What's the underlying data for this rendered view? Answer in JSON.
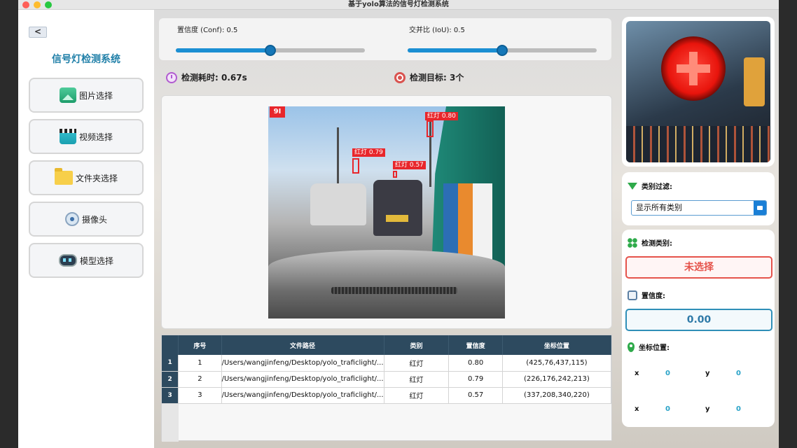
{
  "window": {
    "title": "基于yolo算法的信号灯检测系统"
  },
  "sidebar": {
    "back_label": "<",
    "app_title": "信号灯检测系统",
    "items": [
      {
        "label": "图片选择",
        "icon": "image-icon"
      },
      {
        "label": "视频选择",
        "icon": "video-icon"
      },
      {
        "label": "文件夹选择",
        "icon": "folder-icon"
      },
      {
        "label": "摄像头",
        "icon": "camera-icon"
      },
      {
        "label": "模型选择",
        "icon": "model-icon"
      }
    ]
  },
  "sliders": {
    "conf": {
      "label": "置信度 (Conf): 0.5",
      "value": 0.5
    },
    "iou": {
      "label": "交并比 (IoU): 0.5",
      "value": 0.5
    }
  },
  "stats": {
    "time": "检测耗时: 0.67s",
    "targets": "检测目标: 3个"
  },
  "detections_overlay": {
    "logo": "9I",
    "labels": [
      "红灯 0.80",
      "红灯 0.79",
      "红灯 0.57"
    ]
  },
  "table": {
    "headers": [
      "序号",
      "文件路径",
      "类别",
      "置信度",
      "坐标位置"
    ],
    "rows": [
      {
        "row": "1",
        "id": "1",
        "path": "/Users/wangjinfeng/Desktop/yolo_traficlight/...",
        "cls": "红灯",
        "conf": "0.80",
        "coords": "(425,76,437,115)"
      },
      {
        "row": "2",
        "id": "2",
        "path": "/Users/wangjinfeng/Desktop/yolo_traficlight/...",
        "cls": "红灯",
        "conf": "0.79",
        "coords": "(226,176,242,213)"
      },
      {
        "row": "3",
        "id": "3",
        "path": "/Users/wangjinfeng/Desktop/yolo_traficlight/...",
        "cls": "红灯",
        "conf": "0.57",
        "coords": "(337,208,340,220)"
      }
    ]
  },
  "filter": {
    "title": "类别过滤:",
    "selected": "显示所有类别"
  },
  "info": {
    "class_title": "检测类别:",
    "class_value": "未选择",
    "conf_title": "置信度:",
    "conf_value": "0.00",
    "coord_title": "坐标位置:",
    "x_label": "x",
    "y_label": "y",
    "x1": "0",
    "y1": "0",
    "x2": "0",
    "y2": "0"
  },
  "colors": {
    "accent": "#1b8fd3",
    "header": "#2d4a5f",
    "detection": "#e8262b",
    "class_box": "#e5534b",
    "conf_box": "#2f8fb8"
  }
}
